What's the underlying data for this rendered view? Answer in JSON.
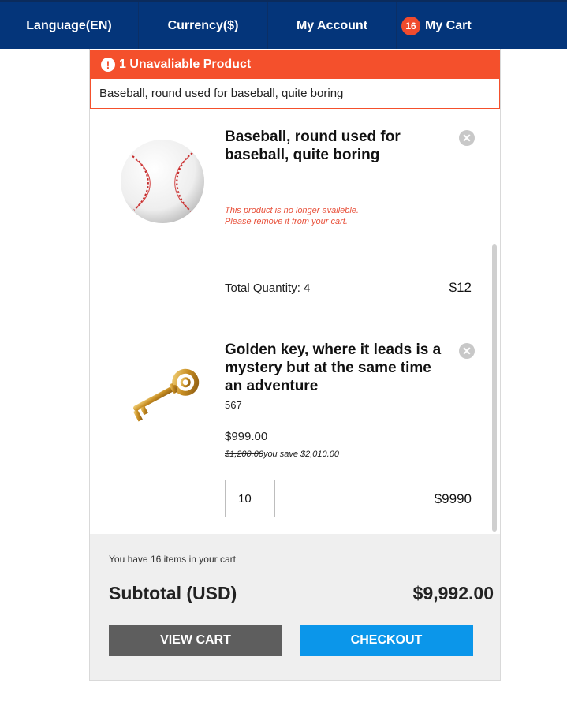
{
  "nav": {
    "language": "Language(EN)",
    "currency": "Currency($)",
    "account": "My Account",
    "cart_count": "16",
    "cart": "My Cart"
  },
  "alert": {
    "icon": "!",
    "title": "1 Unavaliable Product",
    "message": "Baseball, round used for baseball, quite boring"
  },
  "items": [
    {
      "name_line1": "Baseball, round used for",
      "name_line2": "baseball, quite boring",
      "image_icon": "baseball-image",
      "note_line1": "This product is no longer availeble.",
      "note_line2": "Please remove it from your cart.",
      "quantity_label": "Total Quantity: 4",
      "total": "$12"
    },
    {
      "name_line1": "Golden key, where it leads is a",
      "name_line2": "mystery but at the same time",
      "name_line3": "an adventure",
      "image_icon": "golden-key-image",
      "sku": "567",
      "price": "$999.00",
      "old_price": "$1,200.00",
      "savings": "you save $2,010.00",
      "quantity": "10",
      "total": "$9990"
    }
  ],
  "summary": {
    "items_text": "You have 16 items in your cart",
    "subtotal_label": "Subtotal (USD)",
    "subtotal_value": "$9,992.00"
  },
  "buttons": {
    "view_cart": "VIEW CART",
    "checkout": "CHECKOUT"
  },
  "colors": {
    "nav_bg": "#04357a",
    "alert": "#f4502c",
    "view_cart_bg": "#5e5e5e",
    "checkout_bg": "#0b96ea"
  }
}
